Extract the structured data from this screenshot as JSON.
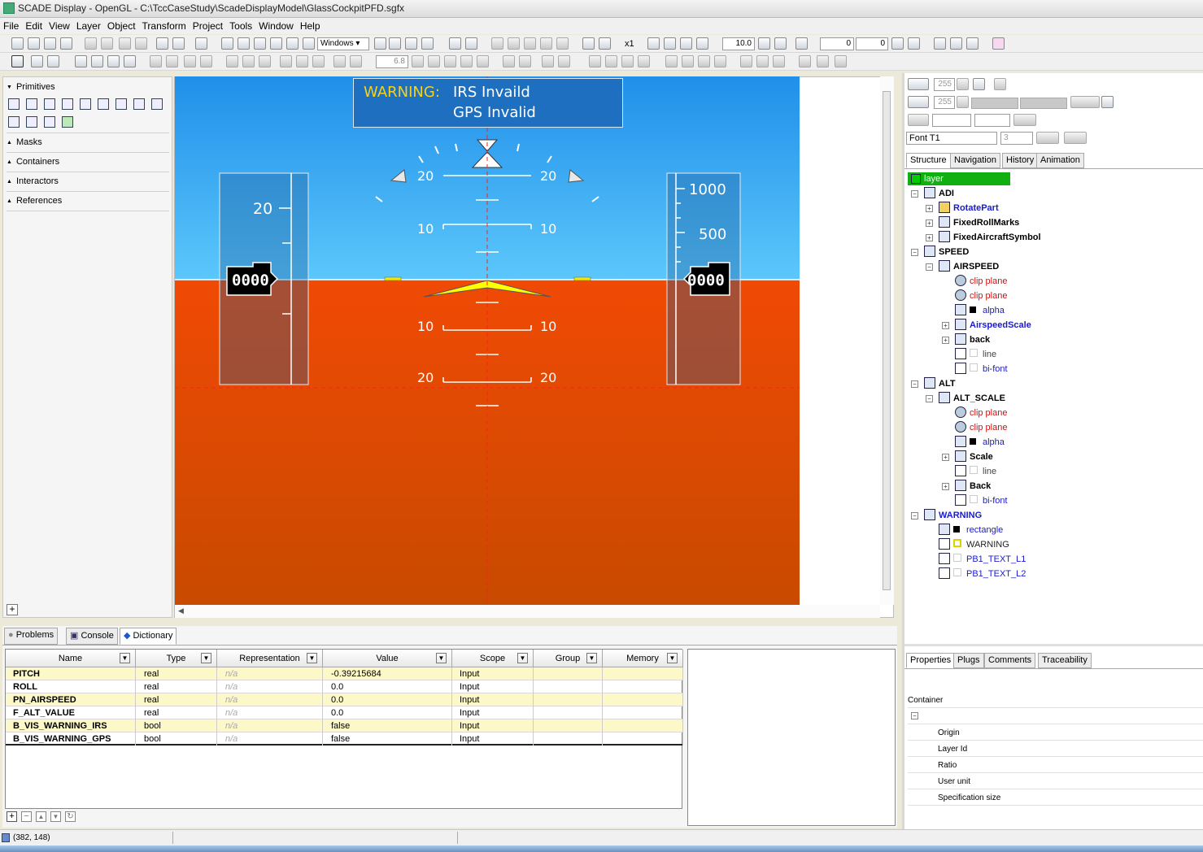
{
  "window": {
    "title": "SCADE Display - OpenGL - C:\\TccCaseStudy\\ScadeDisplayModel\\GlassCockpitPFD.sgfx"
  },
  "menu": [
    "File",
    "Edit",
    "View",
    "Layer",
    "Object",
    "Transform",
    "Project",
    "Tools",
    "Window",
    "Help"
  ],
  "toolbar": {
    "windows_combo": "Windows",
    "zoom_label": "x1",
    "zoom_value": "10.0",
    "x_value": "0",
    "y_value": "0",
    "line_width_value": "6.8"
  },
  "left_panel": {
    "sections": [
      "Primitives",
      "Masks",
      "Containers",
      "Interactors",
      "References"
    ]
  },
  "pfd": {
    "warning_label": "WARNING:",
    "warning_line1": "IRS Invaild",
    "warning_line2": "GPS Invalid",
    "pitch_labels": {
      "p20": "20",
      "p10": "10",
      "m10": "10",
      "m20": "20"
    },
    "speed_tick": "20",
    "speed_readout": "0000",
    "alt_ticks": [
      "1000",
      "500"
    ],
    "alt_readout": "0000",
    "colors": {
      "sky": "#3aa6f2",
      "ground": "#e04a03",
      "warning_label": "#f2d21c",
      "aircraft_symbol": "#ffff00",
      "horizon_marks": "#f5e600",
      "warning_box": "#1e6fc0"
    }
  },
  "right_panel": {
    "line_value1": "255",
    "line_value2": "255",
    "font_combo": "Font T1",
    "font_size": "3",
    "tabs": [
      "Structure",
      "Navigation",
      "History",
      "Animation"
    ],
    "tree": {
      "layer": "layer",
      "adi": "ADI",
      "rotate": "RotatePart",
      "fixedroll": "FixedRollMarks",
      "fixedaircraft": "FixedAircraftSymbol",
      "speed": "SPEED",
      "airspeed": "AIRSPEED",
      "clip1": "clip plane",
      "clip2": "clip plane",
      "alpha1": "alpha",
      "airspeedscale": "AirspeedScale",
      "back1": "back",
      "line1": "line",
      "bifont1": "bi-font",
      "alt": "ALT",
      "altscale": "ALT_SCALE",
      "clip3": "clip plane",
      "clip4": "clip plane",
      "alpha2": "alpha",
      "scale": "Scale",
      "line2": "line",
      "back2": "Back",
      "bifont2": "bi-font",
      "warning": "WARNING",
      "rectangle": "rectangle",
      "warningtext": "WARNING",
      "pb1": "PB1_TEXT_L1",
      "pb2": "PB1_TEXT_L2"
    },
    "prop_tabs": [
      "Properties",
      "Plugs",
      "Comments",
      "Traceability"
    ],
    "properties": {
      "section": "Container",
      "items": [
        "Origin",
        "Layer Id",
        "Ratio",
        "User unit",
        "Specification size"
      ]
    }
  },
  "bottom_panel": {
    "tabs": [
      "Problems",
      "Console",
      "Dictionary"
    ],
    "columns": [
      "Name",
      "Type",
      "Representation",
      "Value",
      "Scope",
      "Group",
      "Memory"
    ],
    "rows": [
      {
        "name": "PITCH",
        "type": "real",
        "rep": "n/a",
        "value": "-0.39215684",
        "scope": "Input"
      },
      {
        "name": "ROLL",
        "type": "real",
        "rep": "n/a",
        "value": "0.0",
        "scope": "Input"
      },
      {
        "name": "PN_AIRSPEED",
        "type": "real",
        "rep": "n/a",
        "value": "0.0",
        "scope": "Input"
      },
      {
        "name": "F_ALT_VALUE",
        "type": "real",
        "rep": "n/a",
        "value": "0.0",
        "scope": "Input"
      },
      {
        "name": "B_VIS_WARNING_IRS",
        "type": "bool",
        "rep": "n/a",
        "value": "false",
        "scope": "Input"
      },
      {
        "name": "B_VIS_WARNING_GPS",
        "type": "bool",
        "rep": "n/a",
        "value": "false",
        "scope": "Input"
      }
    ]
  },
  "status": {
    "coords": "(382, 148)"
  }
}
